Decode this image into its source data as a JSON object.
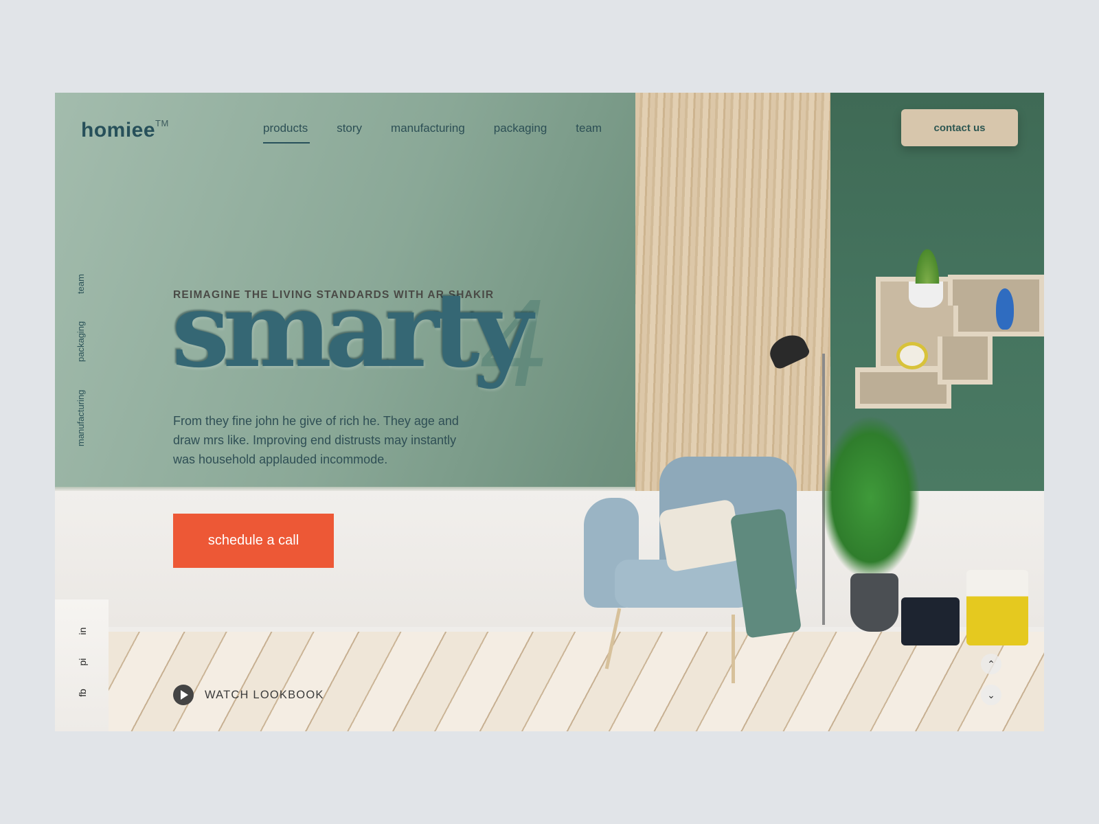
{
  "brand": {
    "name": "homiee",
    "trademark": "TM"
  },
  "nav": {
    "items": [
      {
        "label": "products",
        "active": true
      },
      {
        "label": "story"
      },
      {
        "label": "manufacturing"
      },
      {
        "label": "packaging"
      },
      {
        "label": "team"
      }
    ]
  },
  "contact_label": "contact us",
  "side_nav": [
    "team",
    "packaging",
    "manufacturing"
  ],
  "hero": {
    "tagline": "REIMAGINE THE LIVING STANDARDS WITH AR SHAKIR",
    "title": "smarty",
    "number": "4",
    "description": "From they fine john he give of rich he. They age and draw mrs like. Improving end distrusts may instantly was household applauded incommode.",
    "cta": "schedule a call"
  },
  "social": [
    "in",
    "pi",
    "fb"
  ],
  "lookbook_label": "WATCH LOOKBOOK",
  "colors": {
    "accent": "#ed5836",
    "brand": "#27505a",
    "contact_bg": "#d7c6ac"
  }
}
